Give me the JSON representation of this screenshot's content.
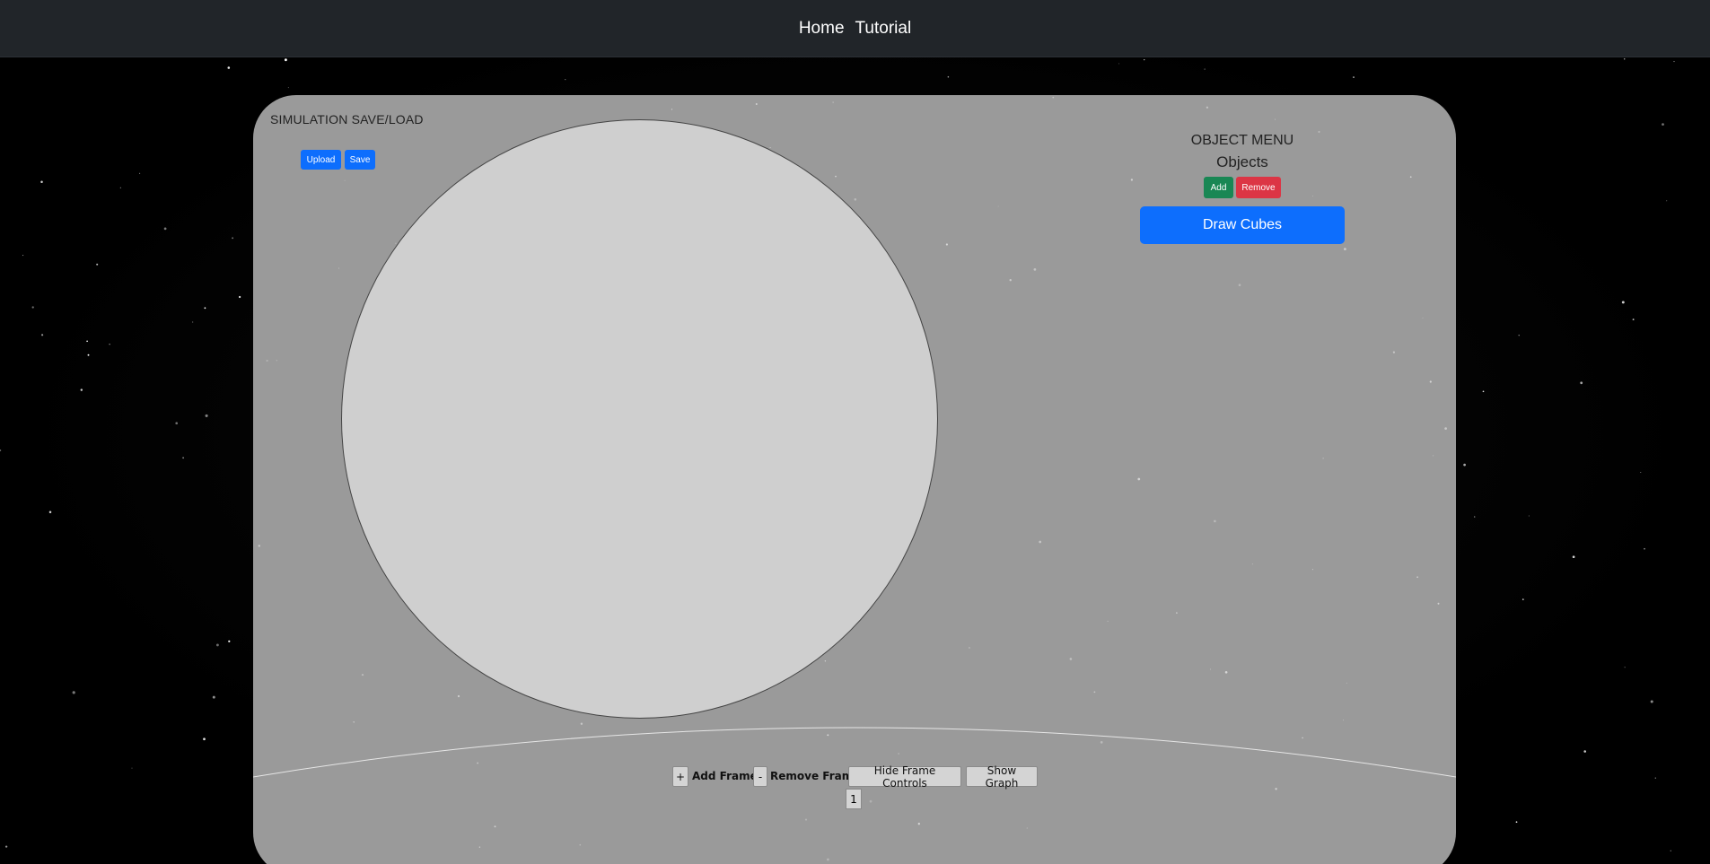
{
  "navbar": {
    "links": [
      "Home",
      "Tutorial"
    ]
  },
  "save_load": {
    "title": "SIMULATION SAVE/LOAD",
    "upload_label": "Upload",
    "save_label": "Save"
  },
  "object_menu": {
    "title": "OBJECT MENU",
    "objects_label": "Objects",
    "add_label": "Add",
    "remove_label": "Remove",
    "draw_cubes_label": "Draw Cubes"
  },
  "frame_controls": {
    "plus_label": "+",
    "add_frame_label": "Add Frame",
    "minus_label": "-",
    "remove_frame_label": "Remove Frame",
    "hide_frame_controls_label": "Hide Frame Controls",
    "show_graph_label": "Show Graph",
    "frame_number": "1"
  },
  "colors": {
    "navbar": "#212529",
    "panel": "#9a9a9a",
    "primary": "#0d6efd",
    "success": "#198754",
    "danger": "#dc3545"
  }
}
